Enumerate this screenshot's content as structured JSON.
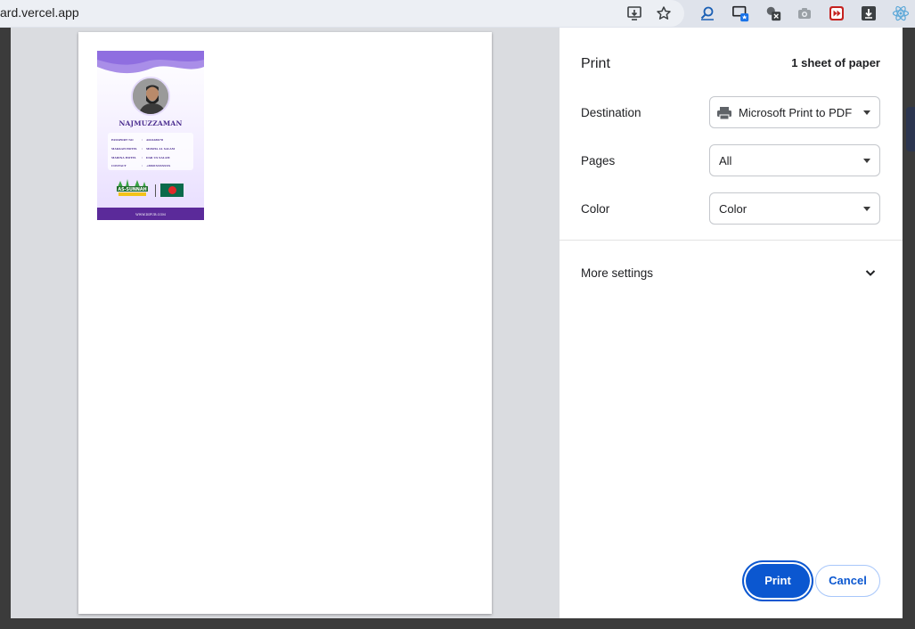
{
  "browser": {
    "url": "ard.vercel.app",
    "icons": [
      "install-app-icon",
      "bookmark-star-icon",
      "zoom-search-icon",
      "cast-screen-icon",
      "extension-dark-icon",
      "camera-icon",
      "media-skip-icon",
      "download-icon",
      "react-devtools-icon"
    ]
  },
  "preview": {
    "card": {
      "name": "NAJMUZZAMAN",
      "rows": [
        {
          "label": "PASSPORT NO",
          "value": "A02448678"
        },
        {
          "label": "MAKKAH HOTEL",
          "value": "MOSHA AL SALAM"
        },
        {
          "label": "MADINA HOTEL",
          "value": "DAR US SALAM"
        },
        {
          "label": "CONTACT",
          "value": "+8801XXXXXXX"
        }
      ],
      "logo_text": "AS-SUNNAH",
      "footer": "WWW.DIFUB.COM"
    }
  },
  "print_panel": {
    "title": "Print",
    "sheets": "1 sheet of paper",
    "destination": {
      "label": "Destination",
      "value": "Microsoft Print to PDF"
    },
    "pages": {
      "label": "Pages",
      "value": "All"
    },
    "color": {
      "label": "Color",
      "value": "Color"
    },
    "more_settings": "More settings",
    "print_button": "Print",
    "cancel_button": "Cancel"
  },
  "colors": {
    "accent": "#0b57d0",
    "card_purple": "#5b2a9a"
  }
}
